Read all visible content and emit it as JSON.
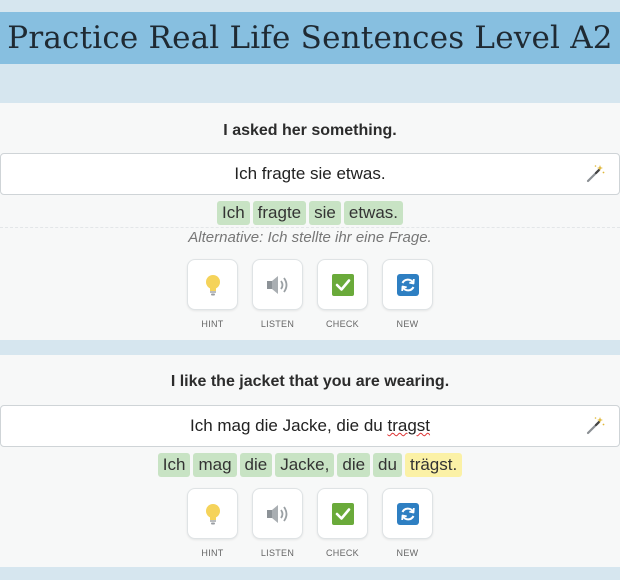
{
  "page": {
    "title": "Practice Real Life Sentences Level A2"
  },
  "exercises": [
    {
      "prompt": "I asked her something.",
      "answer": "Ich fragte sie etwas.",
      "tokens": [
        {
          "text": "Ich",
          "status": "correct"
        },
        {
          "text": "fragte",
          "status": "correct"
        },
        {
          "text": "sie",
          "status": "correct"
        },
        {
          "text": "etwas.",
          "status": "correct"
        }
      ],
      "alternative": "Alternative: Ich stellte ihr eine Frage.",
      "actions": {
        "hint": "HINT",
        "listen": "LISTEN",
        "check": "CHECK",
        "new": "NEW"
      }
    },
    {
      "prompt": "I like the jacket that you are wearing.",
      "answer_prefix": "Ich mag die Jacke, die du ",
      "answer_misspelled": "tragst",
      "tokens": [
        {
          "text": "Ich",
          "status": "correct"
        },
        {
          "text": "mag",
          "status": "correct"
        },
        {
          "text": "die",
          "status": "correct"
        },
        {
          "text": "Jacke,",
          "status": "correct"
        },
        {
          "text": "die",
          "status": "correct"
        },
        {
          "text": "du",
          "status": "correct"
        },
        {
          "text": "trägst.",
          "status": "warning"
        }
      ],
      "actions": {
        "hint": "HINT",
        "listen": "LISTEN",
        "check": "CHECK",
        "new": "NEW"
      }
    }
  ],
  "colors": {
    "header": "#87bfe0",
    "background": "#d6e6ef",
    "token_correct": "#c8e3c4",
    "token_warning": "#fbf1a6",
    "check_green": "#6aaa3a",
    "new_blue": "#2e7fc2",
    "hint_yellow": "#f5d35a"
  },
  "icons": [
    "magic-wand-icon",
    "lightbulb-icon",
    "speaker-icon",
    "checkmark-icon",
    "refresh-icon"
  ]
}
